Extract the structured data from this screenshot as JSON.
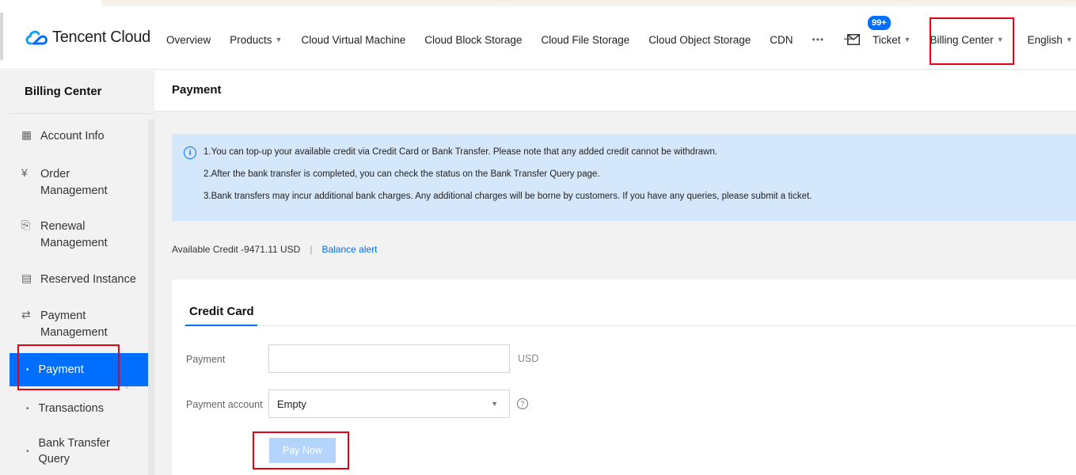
{
  "header": {
    "brand": "Tencent Cloud",
    "nav": [
      {
        "label": "Overview"
      },
      {
        "label": "Products",
        "caret": true
      },
      {
        "label": "Cloud Virtual Machine"
      },
      {
        "label": "Cloud Block Storage"
      },
      {
        "label": "Cloud File Storage"
      },
      {
        "label": "Cloud Object Storage"
      },
      {
        "label": "CDN"
      }
    ],
    "more": "•••",
    "plus": "+",
    "badge": "99+",
    "ticket": "Ticket",
    "billing_center": "Billing Center",
    "language": "English",
    "caret": "▼"
  },
  "sidebar": {
    "title": "Billing Center",
    "items": [
      {
        "label": "Account Info",
        "icon": "grid-icon",
        "glyph": "▦"
      },
      {
        "label": "Order\nManagement",
        "icon": "yen-circle-icon",
        "glyph": "¥"
      },
      {
        "label": "Renewal\nManagement",
        "icon": "renewal-icon",
        "glyph": "⎘"
      },
      {
        "label": "Reserved Instance",
        "icon": "calendar-icon",
        "glyph": "▤"
      },
      {
        "label": "Payment\nManagement",
        "icon": "payment-icon",
        "glyph": "⇄"
      }
    ],
    "sub_items": [
      {
        "label": "Payment",
        "active": true
      },
      {
        "label": "Transactions",
        "active": false
      },
      {
        "label": "Bank Transfer\nQuery",
        "active": false
      }
    ],
    "bullet": "•",
    "chevron": "^"
  },
  "main": {
    "title": "Payment",
    "notice": {
      "icon": "info-icon",
      "icon_glyph": "i",
      "lines": [
        "1.You can top-up your available credit via Credit Card or Bank Transfer. Please note that any added credit cannot be withdrawn.",
        "2.After the bank transfer is completed, you can check the status on the Bank Transfer Query page.",
        "3.Bank transfers may incur additional bank charges. Any additional charges will be borne by customers. If you have any queries, please submit a ticket."
      ]
    },
    "credit": {
      "label": "Available Credit",
      "value": "-9471.11 USD",
      "separator": "|",
      "link": "Balance alert"
    },
    "tab": "Credit Card",
    "form": {
      "payment_label": "Payment",
      "payment_value": "",
      "payment_unit": "USD",
      "account_label": "Payment account",
      "account_value": "Empty",
      "help_glyph": "?",
      "pay_button": "Pay Now"
    }
  },
  "colors": {
    "accent": "#006eff",
    "highlight_box": "#e60012",
    "notice_bg": "#d5e7fa",
    "disabled_button": "#b3d4fc"
  }
}
